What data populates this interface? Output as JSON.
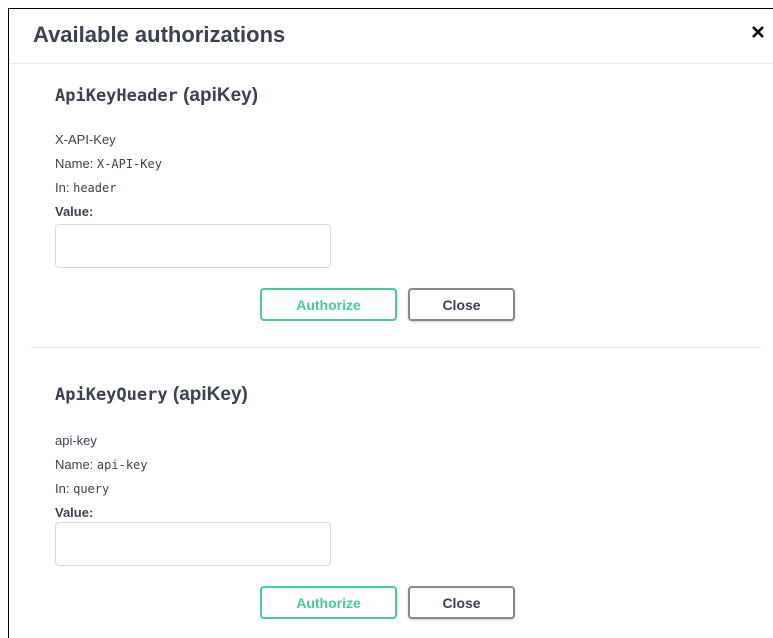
{
  "dialog": {
    "title": "Available authorizations",
    "close_icon": "close-icon"
  },
  "schemes": [
    {
      "name": "ApiKeyHeader",
      "type": "(apiKey)",
      "description": "X-API-Key",
      "name_label": "Name:",
      "name_value": "X-API-Key",
      "in_label": "In:",
      "in_value": "header",
      "value_label": "Value:",
      "value_input": "",
      "authorize_label": "Authorize",
      "close_label": "Close"
    },
    {
      "name": "ApiKeyQuery",
      "type": "(apiKey)",
      "description": "api-key",
      "name_label": "Name:",
      "name_value": "api-key",
      "in_label": "In:",
      "in_value": "query",
      "value_label": "Value:",
      "value_input": "",
      "authorize_label": "Authorize",
      "close_label": "Close"
    }
  ],
  "colors": {
    "authorize_green": "#49cc90",
    "text": "#3b4151",
    "divider": "#ebebeb"
  }
}
